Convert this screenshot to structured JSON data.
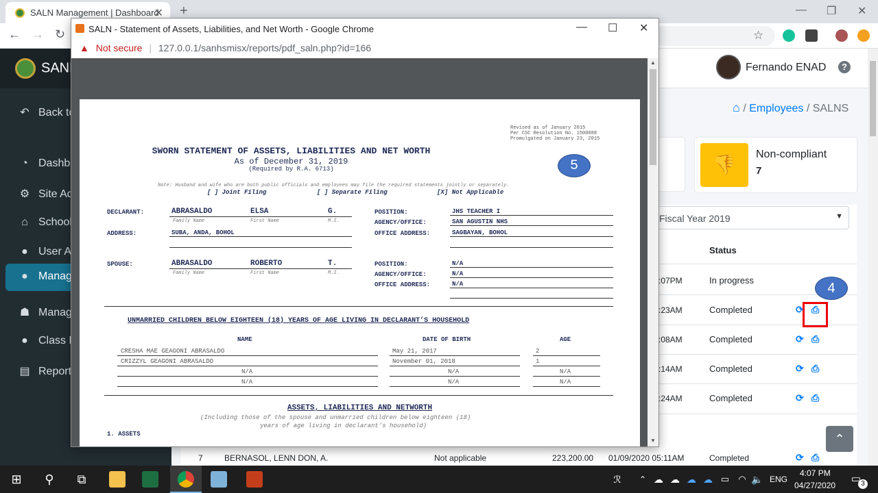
{
  "browser": {
    "tab_title": "SALN Management | Dashboard",
    "new_tab": "+",
    "tab_close": "✕"
  },
  "sidebar": {
    "brand": "SANH",
    "items": [
      {
        "label": "Back to",
        "icon": "undo-icon"
      },
      {
        "label": "Dashbo",
        "icon": "dashboard-icon"
      },
      {
        "label": "Site Ad",
        "icon": "cogs-icon"
      },
      {
        "label": "School",
        "icon": "school-icon"
      },
      {
        "label": "User Ac",
        "icon": "user-icon"
      },
      {
        "label": "Manage",
        "icon": "user-icon",
        "active": true
      },
      {
        "label": "Manage",
        "icon": "graduate-icon"
      },
      {
        "label": "Class M",
        "icon": "user-icon"
      },
      {
        "label": "Report",
        "icon": "file-icon"
      }
    ]
  },
  "header": {
    "username": "Fernando ENAD",
    "help": "?"
  },
  "breadcrumb": {
    "items": [
      "Employees",
      "SALNS"
    ],
    "separator": "/"
  },
  "stats": {
    "noncompliant_label": "Non-compliant",
    "noncompliant_value": "7"
  },
  "filter": {
    "fiscal_year": "Fiscal Year 2019"
  },
  "table": {
    "status_header": "Status",
    "rows": [
      {
        "time": ":07PM",
        "status": "In progress"
      },
      {
        "time": ":23AM",
        "status": "Completed"
      },
      {
        "time": ":08AM",
        "status": "Completed"
      },
      {
        "time": ":14AM",
        "status": "Completed"
      },
      {
        "time": ":24AM",
        "status": "Completed"
      }
    ],
    "last_row": {
      "num": "7",
      "name": "BERNASOL, LENN DON, A.",
      "filing": "Not applicable",
      "amount": "223,200.00",
      "datetime": "01/09/2020 05:11AM",
      "status": "Completed"
    }
  },
  "callouts": {
    "print": "4",
    "pdf": "5"
  },
  "popup": {
    "title": "SALN - Statement of Assets, Liabilities, and Net Worth - Google Chrome",
    "security": "Not secure",
    "url": "127.0.0.1/sanhsmisx/reports/pdf_saln.php?id=166"
  },
  "saln": {
    "revised": [
      "Revised as of January 2015",
      "Per CSC Resolution No. 1500088",
      "Promulgated on January 23, 2015"
    ],
    "title": "SWORN STATEMENT OF ASSETS, LIABILITIES AND NET WORTH",
    "as_of": "As of December 31, 2019",
    "required": "(Required by R.A. 6713)",
    "note": "Note: Husband and wife who are both public officials and employees may file the required statements jointly or separately.",
    "filing_joint": "[ ] Joint Filing",
    "filing_separate": "[ ] Separate Filing",
    "filing_na": "[X] Not Applicable",
    "declarant_label": "DECLARANT:",
    "declarant_last": "ABRASALDO",
    "declarant_first": "ELSA",
    "declarant_mi": "G.",
    "cap_family": "Family Name",
    "cap_first": "First Name",
    "cap_mi": "M.I.",
    "address_label": "ADDRESS:",
    "address": "SUBA, ANDA, BOHOL",
    "position_label": "POSITION:",
    "position": "JHS TEACHER I",
    "agency_label": "AGENCY/OFFICE:",
    "agency": "SAN AGUSTIN NHS",
    "office_address_label": "OFFICE ADDRESS:",
    "office_address": "SAGBAYAN, BOHOL",
    "spouse_label": "SPOUSE:",
    "spouse_last": "ABRASALDO",
    "spouse_first": "ROBERTO",
    "spouse_mi": "T.",
    "spouse_position": "N/A",
    "spouse_agency": "N/A",
    "spouse_office_address": "N/A",
    "children_heading": "UNMARRIED CHILDREN BELOW EIGHTEEN (18) YEARS OF AGE LIVING IN DECLARANT’S  HOUSEHOLD",
    "col_name": "NAME",
    "col_dob": "DATE OF BIRTH",
    "col_age": "AGE",
    "children": [
      {
        "name": "CRESHA MAE GEAGONI ABRASALDO",
        "dob": "May 21, 2017",
        "age": "2"
      },
      {
        "name": "CRIZZYL GEAGONI ABRASALDO",
        "dob": "November 01, 2018",
        "age": "1"
      },
      {
        "name": "N/A",
        "dob": "N/A",
        "age": "N/A"
      },
      {
        "name": "N/A",
        "dob": "N/A",
        "age": "N/A"
      }
    ],
    "assets_heading": "ASSETS, LIABILITIES AND NETWORTH",
    "assets_sub1": "(Including those of the spouse and unmarried children below eighteen (18)",
    "assets_sub2": "years of age living in declarant’s household)",
    "assets_item": "1. ASSETS"
  },
  "taskbar": {
    "time": "4:07 PM",
    "date": "04/27/2020",
    "lang": "ENG",
    "notif": "3"
  }
}
